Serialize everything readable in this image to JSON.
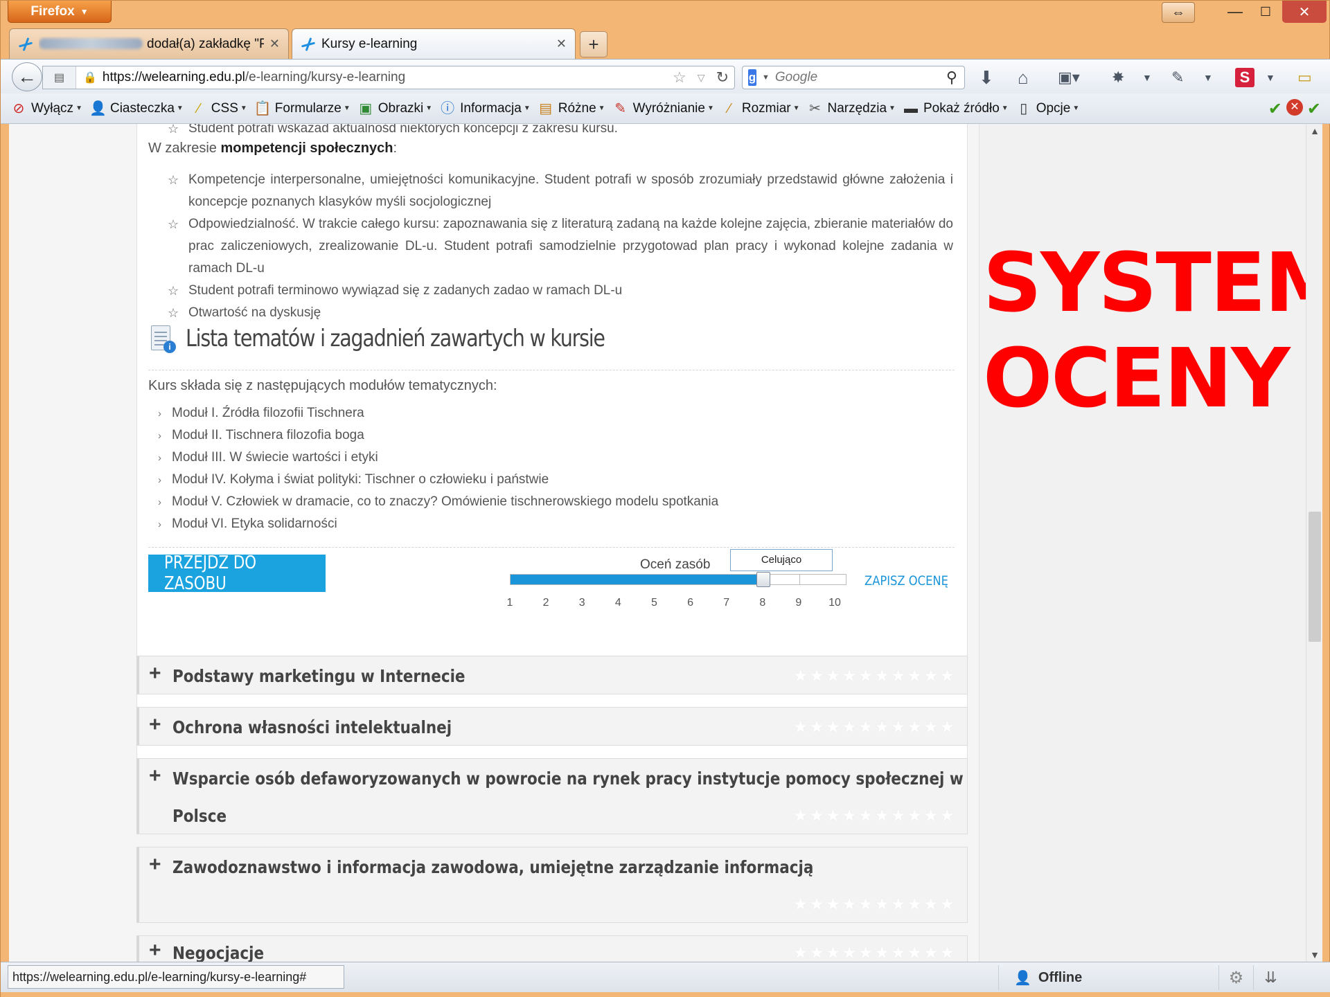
{
  "browser": {
    "menu_button": "Firefox",
    "tabs": [
      {
        "title": "dodał(a) zakładkę \"P...",
        "active": false
      },
      {
        "title": "Kursy e-learning",
        "active": true
      }
    ],
    "url_host": "https://welearning.edu.pl",
    "url_path": "/e-learning/kursy-e-learning",
    "search_placeholder": "Google"
  },
  "devbar": {
    "items": [
      {
        "label": "Wyłącz",
        "icon": "disable-icon"
      },
      {
        "label": "Ciasteczka",
        "icon": "cookie-icon"
      },
      {
        "label": "CSS",
        "icon": "css-icon"
      },
      {
        "label": "Formularze",
        "icon": "form-icon"
      },
      {
        "label": "Obrazki",
        "icon": "image-icon"
      },
      {
        "label": "Informacja",
        "icon": "info-icon"
      },
      {
        "label": "Różne",
        "icon": "misc-icon"
      },
      {
        "label": "Wyróżnianie",
        "icon": "highlight-icon"
      },
      {
        "label": "Rozmiar",
        "icon": "ruler-icon"
      },
      {
        "label": "Narzędzia",
        "icon": "tools-icon"
      },
      {
        "label": "Pokaż źródło",
        "icon": "source-icon"
      },
      {
        "label": "Opcje",
        "icon": "options-icon"
      }
    ]
  },
  "content": {
    "top_line": "Student potrafi wskazad aktualnośd niektórych koncepcji z zakresu kursu.",
    "competence_prefix": "W zakresie ",
    "competence_bold": "mompetencji społecznych",
    "competence_suffix": ":",
    "competences": [
      "Kompetencje interpersonalne, umiejętności komunikacyjne. Student potrafi w sposób zrozumiały przedstawid główne założenia i koncepcje poznanych klasyków myśli socjologicznej",
      "Odpowiedzialność. W trakcie całego kursu: zapoznawania się z literaturą zadaną na każde kolejne zajęcia, zbieranie materiałów do prac zaliczeniowych, zrealizowanie DL-u. Student potrafi samodzielnie przygotowad plan pracy i wykonad kolejne zadania w ramach DL-u",
      "Student potrafi terminowo wywiązad się z zadanych zadao w ramach DL-u",
      "Otwartość na dyskusję"
    ],
    "list_heading": "Lista tematów i zagadnień zawartych w kursie",
    "modules_intro": "Kurs składa się z następujących modułów tematycznych:",
    "modules": [
      "Moduł I. Źródła filozofii Tischnera",
      "Moduł II. Tischnera filozofia boga",
      "Moduł III. W świecie wartości i etyki",
      "Moduł IV. Kołyma i świat polityki: Tischner o człowieku i państwie",
      "Moduł V. Człowiek w dramacie, co to znaczy? Omówienie tischnerowskiego modelu spotkania",
      "Moduł VI. Etyka solidarności"
    ],
    "go_button": "PRZEJDŹ DO ZASOBU",
    "rate_label": "Oceń zasób",
    "rating_tooltip": "Celująco",
    "rating_value": 8,
    "rating_max": 10,
    "rating_ticks": [
      "1",
      "2",
      "3",
      "4",
      "5",
      "6",
      "7",
      "8",
      "9",
      "10"
    ],
    "save_rating": "ZAPISZ OCENĘ"
  },
  "courses": [
    {
      "title": "Podstawy marketingu w Internecie",
      "title2": ""
    },
    {
      "title": "Ochrona własności intelektualnej",
      "title2": ""
    },
    {
      "title": "Wsparcie osób defaworyzowanych w powrocie na rynek pracy instytucje pomocy społecznej w",
      "title2": "Polsce"
    },
    {
      "title": "Zawodoznawstwo i informacja zawodowa, umiejętne zarządzanie informacją",
      "title2": ""
    },
    {
      "title": "Negocjacje",
      "title2": ""
    }
  ],
  "course_stars": "★★★★★★★★★★",
  "overlay_text": {
    "line1": "SYSTEM",
    "line2": "OCENY"
  },
  "statusbar": {
    "url": "https://welearning.edu.pl/e-learning/kursy-e-learning#",
    "presence": "Offline"
  },
  "colors": {
    "accent": "#1ba3e0",
    "overlay": "#ff0000",
    "chrome": "#f3b675"
  }
}
